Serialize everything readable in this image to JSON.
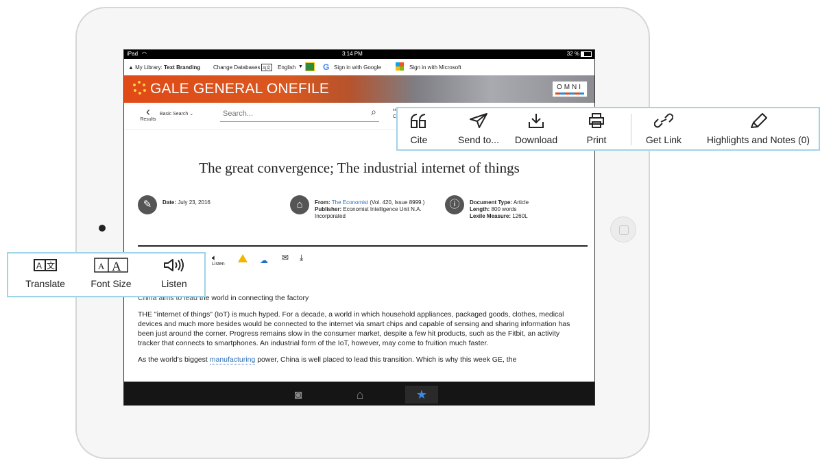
{
  "status": {
    "device": "iPad",
    "time": "3:14 PM",
    "battery": "32 %"
  },
  "toolbar": {
    "library_prefix": "▲ My Library:",
    "library_name": "Text Branding",
    "change_db": "Change Databases",
    "lang": "English",
    "sign_google": "Sign in with Google",
    "sign_microsoft": "Sign in with Microsoft"
  },
  "banner": {
    "brand": "GALE GENERAL ONEFILE",
    "omni": "OMNI"
  },
  "search": {
    "back_label": "Results",
    "mode": "Basic Search",
    "placeholder": "Search...",
    "cite_fragment": "Cit"
  },
  "article": {
    "title": "The great convergence; The industrial internet of things",
    "date_label": "Date:",
    "date": "July 23, 2016",
    "from_label": "From:",
    "from_source": "The Economist",
    "from_detail": "(Vol. 420, Issue 8999.)",
    "publisher_label": "Publisher:",
    "publisher": "Economist Intelligence Unit N.A. Incorporated",
    "doctype_label": "Document Type:",
    "doctype": "Article",
    "length_label": "Length:",
    "length": "800 words",
    "lexile_label": "Lexile Measure:",
    "lexile": "1260L",
    "listen_mini": "Listen",
    "subtitle_tail": "the world in connecting the factory",
    "subtitle_obscured_fragment": "China aims to lead",
    "para1": "THE \"internet of things\" (IoT) is much hyped. For a decade, a world in which household appliances, packaged goods, clothes, medical devices and much more besides would be connected to the internet via smart chips and capable of sensing and sharing information has been just around the corner. Progress remains slow in the consumer market, despite a few hit products, such as the Fitbit, an activity tracker that connects to smartphones. An industrial form of the IoT, however, may come to fruition much faster.",
    "para2_a": "As the world's biggest ",
    "para2_link": "manufacturing",
    "para2_b": " power, China is well placed to lead this transition. Which is why this week GE, the"
  },
  "callout_top": {
    "items": [
      {
        "label": "Cite",
        "icon": "quote-icon"
      },
      {
        "label": "Send to...",
        "icon": "paper-plane-icon"
      },
      {
        "label": "Download",
        "icon": "download-icon"
      },
      {
        "label": "Print",
        "icon": "printer-icon"
      },
      {
        "label": "Get Link",
        "icon": "link-icon"
      },
      {
        "label": "Highlights and Notes (0)",
        "icon": "highlighter-icon"
      }
    ]
  },
  "callout_left": {
    "items": [
      {
        "label": "Translate",
        "icon": "translate-icon"
      },
      {
        "label": "Font Size",
        "icon": "font-size-icon"
      },
      {
        "label": "Listen",
        "icon": "speaker-icon"
      }
    ]
  },
  "colors": {
    "accent": "#e04a17",
    "callout_border": "#9ed3ea",
    "link": "#2a6db5",
    "active_tab": "#3a8be8"
  }
}
